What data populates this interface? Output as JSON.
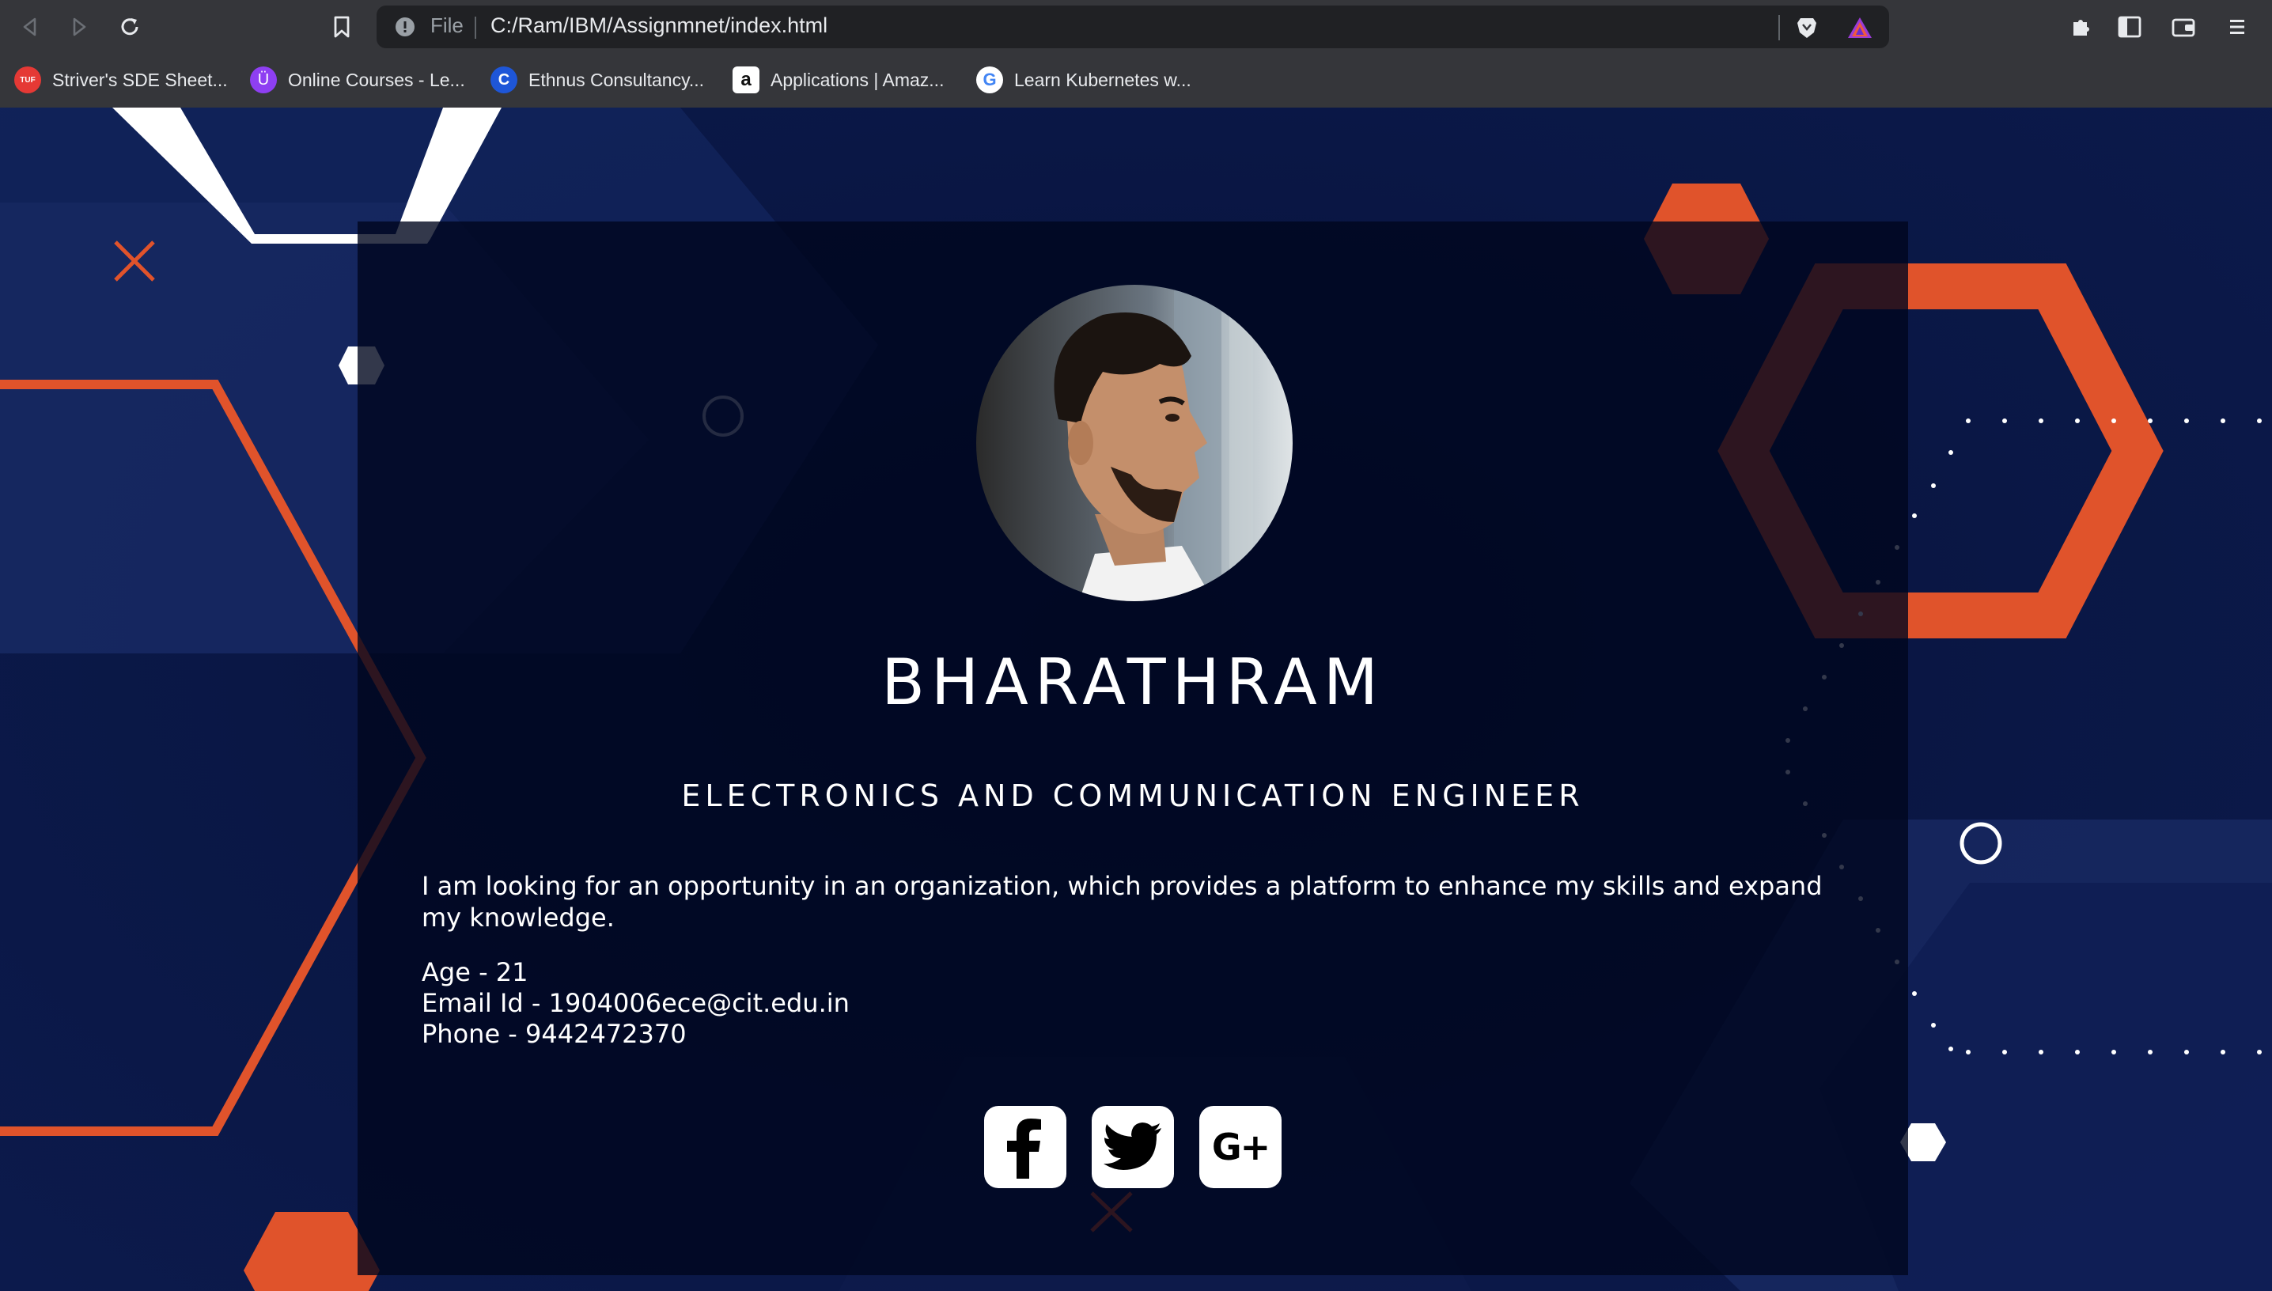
{
  "browser": {
    "file_label": "File",
    "url": "C:/Ram/IBM/Assignmnet/index.html",
    "bookmarks": [
      {
        "label": "Striver's SDE Sheet...",
        "icon": "tuf-icon",
        "icon_text": "TUF",
        "color": "#e53935"
      },
      {
        "label": "Online Courses - Le...",
        "icon": "udemy-icon",
        "icon_text": "Ü",
        "color": "#8e3ff2"
      },
      {
        "label": "Ethnus Consultancy...",
        "icon": "ethnus-icon",
        "icon_text": "C",
        "color": "#1e56d8"
      },
      {
        "label": "Applications | Amaz...",
        "icon": "amazon-icon",
        "icon_text": "a",
        "color": "#ffffff"
      },
      {
        "label": "Learn Kubernetes w...",
        "icon": "google-icon",
        "icon_text": "G",
        "color": "#ffffff"
      }
    ]
  },
  "profile": {
    "name": "BHARATHRAM",
    "role": "ELECTRONICS AND COMMUNICATION ENGINEER",
    "about": "I am looking for an opportunity in an organization, which provides a platform to enhance my skills and expand my knowledge.",
    "age": "Age - 21",
    "email": "Email Id - 1904006ece@cit.edu.in",
    "phone": "Phone - 9442472370"
  },
  "socials": [
    {
      "name": "facebook",
      "icon": "facebook-icon"
    },
    {
      "name": "twitter",
      "icon": "twitter-icon"
    },
    {
      "name": "google-plus",
      "icon": "google-plus-icon",
      "text": "G+"
    }
  ],
  "colors": {
    "accent_orange": "#e0532b",
    "background_navy": "#0a1745",
    "card": "#00061e"
  }
}
